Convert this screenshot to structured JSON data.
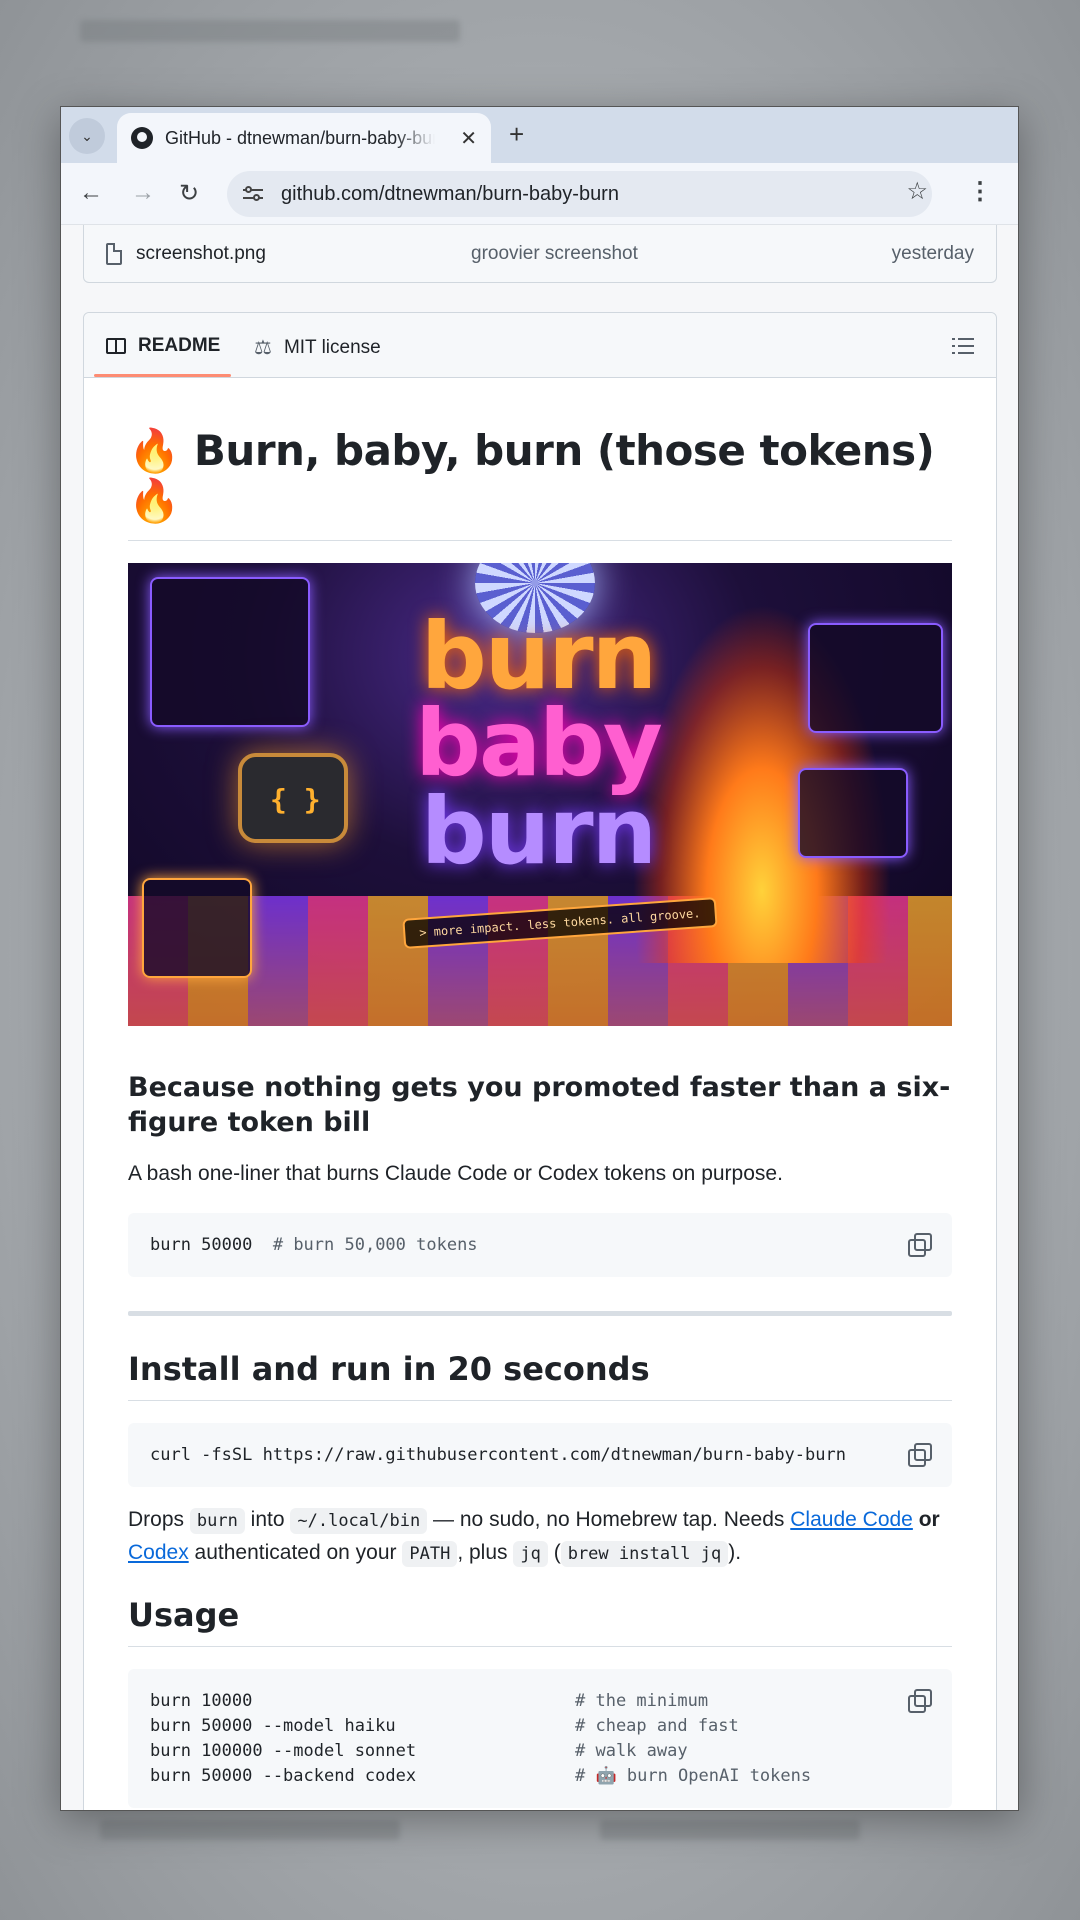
{
  "browser": {
    "tab_title": "GitHub - dtnewman/burn-baby-burn",
    "url": "github.com/dtnewman/burn-baby-burn"
  },
  "file_row": {
    "name": "screenshot.png",
    "commit_message": "groovier screenshot",
    "date": "yesterday"
  },
  "readme_tabs": {
    "readme_label": "README",
    "license_label": "MIT license"
  },
  "readme": {
    "title": "🔥 Burn, baby, burn (those tokens) 🔥",
    "hero_image": {
      "line1": "burn",
      "line2": "baby",
      "line3": "burn",
      "tagline": "> more impact. less tokens. all groove."
    },
    "subtitle": "Because nothing gets you promoted faster than a six-figure token bill",
    "intro": "A bash one-liner that burns Claude Code or Codex tokens on purpose.",
    "example_code": {
      "cmd": "burn 50000",
      "comment": "# burn 50,000 tokens"
    },
    "install_heading": "Install and run in 20 seconds",
    "install_code": "curl -fsSL https://raw.githubusercontent.com/dtnewman/burn-baby-burn",
    "install_text": {
      "drops": "Drops",
      "burn_code": "burn",
      "into": "into",
      "path_code": "~/.local/bin",
      "no_sudo": "— no sudo, no Homebrew tap. Needs",
      "claude_link": "Claude Code",
      "or": "or",
      "codex_link": "Codex",
      "authenticated": "authenticated on your",
      "path_var": "PATH",
      "plus": ", plus",
      "jq_code": "jq",
      "open_paren": "(",
      "brew_code": "brew install jq",
      "close_paren": ")."
    },
    "usage_heading": "Usage",
    "usage_lines": [
      {
        "cmd": "burn 10000",
        "comment": "# the minimum"
      },
      {
        "cmd": "burn 50000 --model haiku",
        "comment": "# cheap and fast"
      },
      {
        "cmd": "burn 100000 --model sonnet",
        "comment": "# walk away"
      },
      {
        "cmd": "burn 50000 --backend codex",
        "comment": "# 🤖 burn OpenAI tokens"
      }
    ]
  }
}
